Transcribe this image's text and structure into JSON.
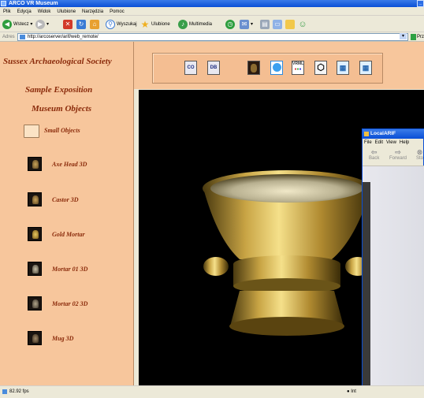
{
  "window": {
    "title": "ARCO VR Museum"
  },
  "menu": [
    "Plik",
    "Edycja",
    "Widok",
    "Ulubione",
    "Narzędzia",
    "Pomoc"
  ],
  "toolbar": {
    "back": "Wstecz",
    "search": "Wyszukaj",
    "favorites": "Ulubione",
    "multimedia": "Multimedia"
  },
  "address": {
    "label": "Adres",
    "url": "http://arcoserver/arif/web_remote/",
    "go": "Prz"
  },
  "sidebar": {
    "society": "Sussex Archaeological Society",
    "exposition": "Sample Exposition",
    "objects_heading": "Museum Objects",
    "folder": "Small Objects",
    "items": [
      {
        "label": "Axe Head 3D"
      },
      {
        "label": "Castor 3D"
      },
      {
        "label": "Gold Mortar"
      },
      {
        "label": "Mortar 01 3D"
      },
      {
        "label": "Mortar 02 3D"
      },
      {
        "label": "Mug 3D"
      }
    ]
  },
  "viewer_toolbar": {
    "co_label": "CO",
    "db_label": "DB",
    "vrml_label": "VRML"
  },
  "status": {
    "fps": "82.92 fps",
    "zone": "Int"
  },
  "popup": {
    "title": "LocalARIF",
    "menu": [
      "File",
      "Edit",
      "View",
      "Help"
    ],
    "back": "Back",
    "forward": "Forward",
    "stop": "Sto"
  }
}
